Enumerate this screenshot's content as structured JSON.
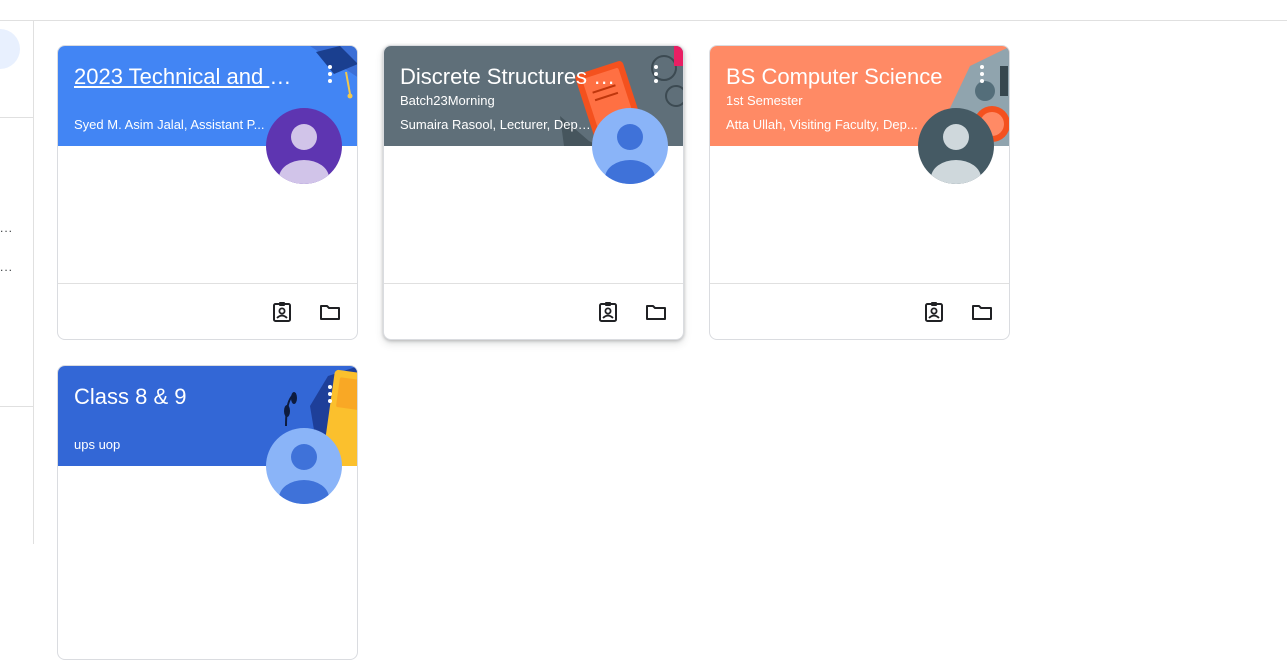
{
  "colors": {
    "blue_banner": "#4285f4",
    "slate_banner": "#5f6f79",
    "orange_banner": "#ff8a65",
    "royal_banner": "#3367d6",
    "avatar_purple": "#5e35b1",
    "avatar_lightblue": "#8ab4f8",
    "avatar_dark": "#455a64"
  },
  "sidebar": {
    "items": [
      {
        "label": "..."
      },
      {
        "label": "..."
      }
    ]
  },
  "classes": [
    {
      "title": "2023 Technical and S...",
      "section": "",
      "teacher": "Syed M. Asim Jalal, Assistant P...",
      "banner_color": "#4285f4",
      "avatar_icon": "person-icon",
      "footer_icons": [
        "assignment-icon",
        "folder-icon"
      ]
    },
    {
      "title": "Discrete Structures B...",
      "section": "Batch23Morning",
      "teacher": "Sumaira Rasool, Lecturer, Depar...",
      "banner_color": "#5f6f79",
      "avatar_icon": "person-icon",
      "footer_icons": [
        "assignment-icon",
        "folder-icon"
      ]
    },
    {
      "title": "BS Computer Science",
      "section": "1st Semester",
      "teacher": "Atta Ullah, Visiting Faculty, Dep...",
      "banner_color": "#ff8a65",
      "avatar_icon": "person-icon",
      "footer_icons": [
        "assignment-icon",
        "folder-icon"
      ]
    },
    {
      "title": "Class 8 & 9",
      "section": "",
      "teacher": "ups uop",
      "banner_color": "#3367d6",
      "avatar_icon": "person-icon",
      "footer_icons": []
    }
  ]
}
